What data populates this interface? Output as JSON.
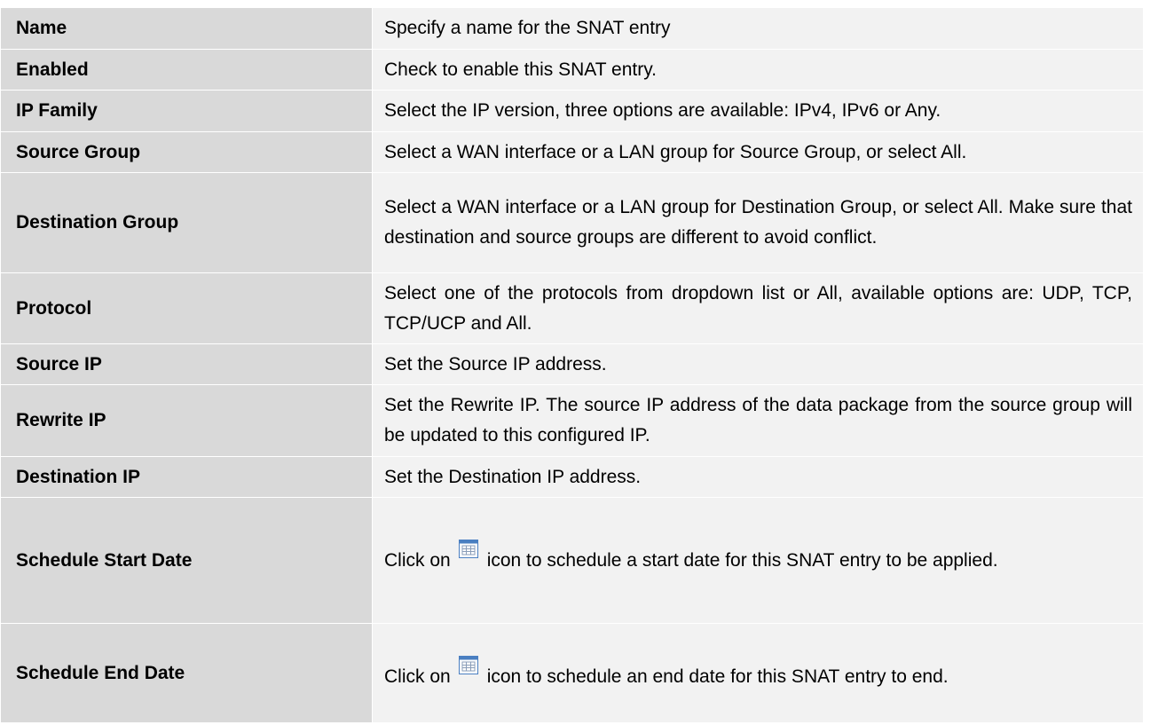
{
  "rows": [
    {
      "label": "Name",
      "desc": "Specify a name for the SNAT entry"
    },
    {
      "label": "Enabled",
      "desc": "Check to enable this SNAT entry."
    },
    {
      "label": "IP Family",
      "desc": "Select the IP version, three options are available: IPv4, IPv6 or Any."
    },
    {
      "label": "Source Group",
      "desc": "Select a WAN interface or a LAN group for Source Group, or select All."
    },
    {
      "label": "Destination Group",
      "desc": "Select a WAN interface or a LAN group for Destination Group, or select All. Make sure that destination and source groups are different to avoid conflict."
    },
    {
      "label": "Protocol",
      "desc": "Select one of the protocols from dropdown list or All, available options are: UDP, TCP, TCP/UCP and All."
    },
    {
      "label": "Source IP",
      "desc": "Set the Source IP address."
    },
    {
      "label": "Rewrite IP",
      "desc": "Set the Rewrite IP. The source IP address of the data package from the source group will be updated to this configured IP."
    },
    {
      "label": "Destination IP",
      "desc": "Set the Destination IP address."
    },
    {
      "label": "Schedule Start Date",
      "desc_before": "Click on",
      "desc_after": "icon to schedule a start date for this SNAT entry to be applied.",
      "icon": "calendar-icon"
    },
    {
      "label": "Schedule End Date",
      "desc_before": "Click on",
      "desc_after": "icon to schedule an end date for this SNAT entry to end.",
      "icon": "calendar-icon"
    }
  ],
  "colors": {
    "label_bg": "#d9d9d9",
    "desc_bg": "#f2f2f2",
    "icon_blue": "#4a7fc1"
  }
}
